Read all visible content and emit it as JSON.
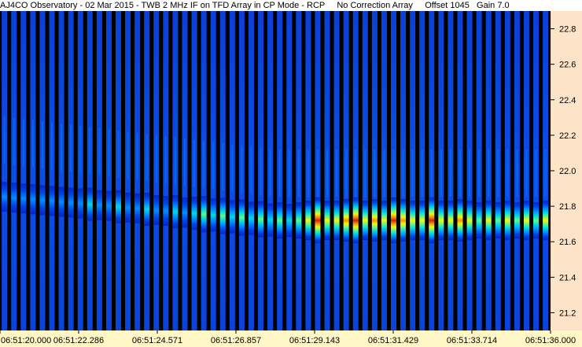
{
  "header": {
    "observatory": "AJ4CO Observatory",
    "date": "02 Mar 2015",
    "description": "TWB 2 MHz IF on TFD Array in CP Mode - RCP",
    "correction": "No Correction Array",
    "offset": "Offset 1045",
    "gain": "Gain 7.0"
  },
  "chart_data": {
    "type": "heatmap",
    "title": "",
    "xlabel": "",
    "ylabel": "",
    "x_ticks": [
      "06:51:20.000",
      "06:51:22.286",
      "06:51:24.571",
      "06:51:26.857",
      "06:51:29.143",
      "06:51:31.429",
      "06:51:33.714",
      "06:51:36.000"
    ],
    "y_ticks": [
      21.2,
      21.4,
      21.6,
      21.8,
      22.0,
      22.2,
      22.4,
      22.6,
      22.8
    ],
    "ylim": [
      21.1,
      22.9
    ],
    "x_range": [
      "06:51:20.000",
      "06:51:36.000"
    ],
    "num_sweeps": 58,
    "burst_freq": 21.72,
    "colormap": [
      "#00008a",
      "#0022c8",
      "#0046e6",
      "#0090ff",
      "#00e0e0",
      "#66ff88",
      "#ffff00",
      "#ff9900",
      "#dd2200"
    ],
    "background_color": "#000000",
    "y_axis_bg": "#fde3c7",
    "x_axis_bg": "#fff7c6"
  }
}
